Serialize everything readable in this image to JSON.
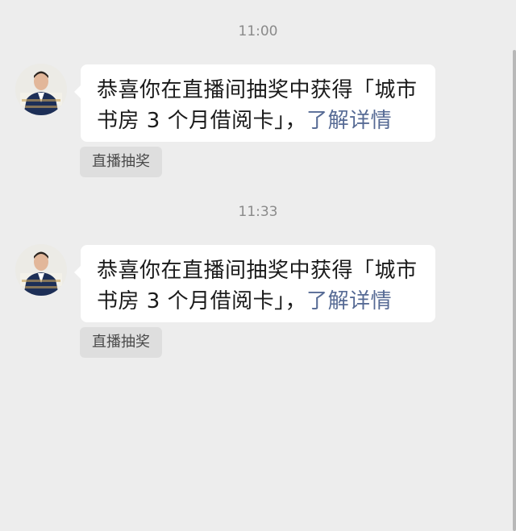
{
  "messages": [
    {
      "time": "11:00",
      "text": "恭喜你在直播间抽奖中获得「城市书房 3 个月借阅卡」，",
      "link": "了解详情",
      "tag": "直播抽奖"
    },
    {
      "time": "11:33",
      "text": "恭喜你在直播间抽奖中获得「城市书房 3 个月借阅卡」，",
      "link": "了解详情",
      "tag": "直播抽奖"
    }
  ],
  "colors": {
    "background": "#ededed",
    "bubble": "#ffffff",
    "link": "#576b95",
    "tag_bg": "#dedede",
    "time_text": "#8a8a8a"
  }
}
